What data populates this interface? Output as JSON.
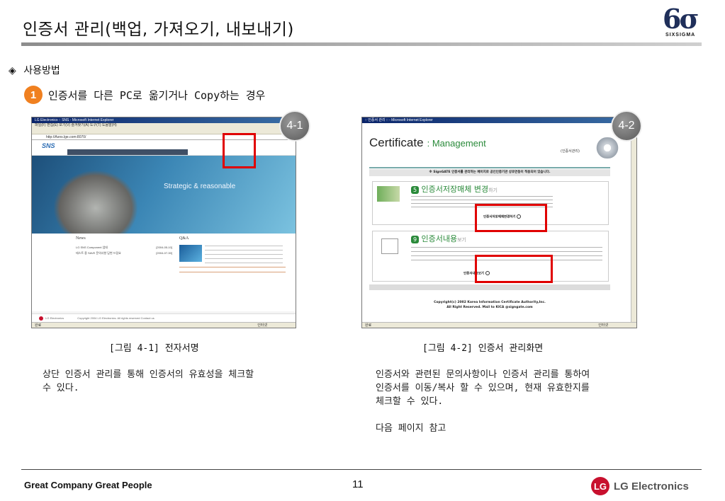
{
  "page": {
    "title": "인증서 관리(백업, 가져오기, 내보내기)",
    "logo": {
      "mark": "6σ",
      "text": "SIXSIGMA"
    },
    "section_label": "사용방법",
    "section_bullet": "◈",
    "step": {
      "number": "1",
      "text": "인증서를 다른 PC로 옮기거나 Copy하는 경우"
    }
  },
  "figure1": {
    "badge": "4-1",
    "window_title": "LG Electronics :: SNS - Microsoft Internet Explorer",
    "address": "http://Asns.lge.com:8070/",
    "menu": "파일(F)  편집(E)  보기(V)  즐겨찾기(A)  도구(T)  도움말(H)",
    "site_logo": "SNS",
    "banner_text": "Strategic & reasonable",
    "news_title": "News",
    "news_items": [
      "LG SNS Component 업데",
      "테스트 중 SAVE 문의사항 답변 드림요"
    ],
    "news_dates": [
      "[2004-05-10]",
      "[2004-07-30]"
    ],
    "qa_title": "Q&A",
    "footer_company": "LG Electronics",
    "copyright": "Copyright 2004 LG Electronics. All rights reserved Contact us",
    "status": "완료",
    "status_right": "인터넷",
    "caption": "[그림 4-1] 전자서명"
  },
  "figure2": {
    "badge": "4-2",
    "window_title": ":: 인증서 관리 :: - Microsoft Internet Explorer",
    "header_word": "Certificate",
    "header_sub": ": Management",
    "header_tag": "(인증서관리)",
    "notice": "※ SignGATE 인증서를 관리하는 페이지로 공인인증기관 상호연동이 적용되어 있습니다.",
    "section1_num": "5",
    "section1_title": "인증서저장매체 변경",
    "section1_suffix": "하기",
    "section1_button": "인증서저장매체변경하기",
    "section2_num": "9",
    "section2_title": "인증서내용",
    "section2_suffix": "보기",
    "section2_button": "인증서내용보기",
    "copyright_line1": "Copyright(c) 2002 Korea Information Certificate Authority,Inc.",
    "copyright_line2": "All Right Reserved. Mail to KICA @signgate.com",
    "status": "완료",
    "status_right": "인터넷",
    "caption": "[그림 4-2] 인증서 관리화면"
  },
  "text": {
    "left_para": [
      "상단 인증서 관리를 통해 인증서의 유효성을 체크할",
      "수 있다."
    ],
    "right_para": [
      "인증서와 관련된 문의사항이나 인증서 관리를 통하여",
      "인증서를 이동/복사 할 수 있으며, 현재 유효한지를",
      "체크할 수 있다."
    ],
    "right_note": "다음 페이지 참고"
  },
  "footer": {
    "slogan": "Great Company Great People",
    "page_number": "11",
    "brand_mark": "LG",
    "brand": "LG Electronics"
  },
  "colors": {
    "accent": "#f08020",
    "highlight": "#e00000",
    "brand": "#c8102e"
  }
}
